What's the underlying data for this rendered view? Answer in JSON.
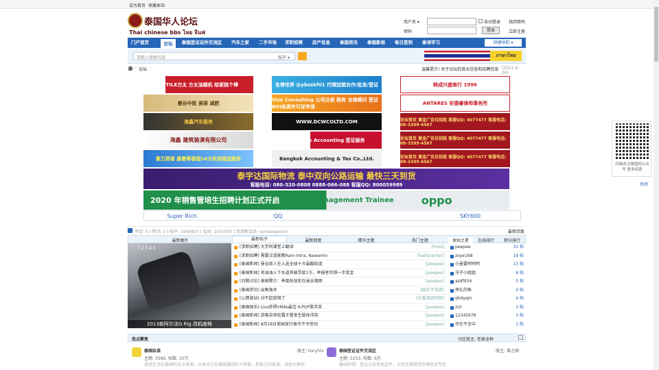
{
  "topbar": {
    "set_home": "设为首页",
    "bookmark": "收藏本站"
  },
  "logo": {
    "cn": "泰国华人论坛",
    "en": "Thai chinese bbs ไทย จีนฟอรั่ม"
  },
  "login": {
    "username_label": "用户名 ▾",
    "password_label": "密码",
    "auto_login": "自动登录",
    "forgot": "找回密码",
    "login_btn": "登录",
    "register": "立即注册"
  },
  "nav": {
    "items": [
      "门户首页",
      "论坛",
      "泰国签证证件交流区",
      "汽车之家",
      "二手市场",
      "求职招聘",
      "房产信息",
      "泰国资讯",
      "泰国影视",
      "每日签到",
      "泰语学习"
    ],
    "active_index": 1,
    "quick": "快捷导航 ▾",
    "colors": {
      "bar": "#2566b8"
    }
  },
  "search": {
    "placeholder": "请输入搜索内容",
    "type": "帖子 ▾",
    "thai_label": "ภาษาไทย"
  },
  "breadcrumb": {
    "current": "论坛",
    "notice": "温馨提示! 关于论坛的商业信息和招聘信息",
    "notice_date": "(2011-6-26)"
  },
  "ads": {
    "row1": [
      "FOTILE方太 方太油烟机 给家挑个棒",
      "名律世界 @ybzskf01 代理加盟合作/批发/签证",
      "韩成兴盛商行 1996"
    ],
    "row2": [
      "曼谷中医 美容 减肥",
      "Vize Consulting 公司注册 税务 法律顾问 签证 BOI各类许可证申请",
      "ANTARES 安德睿律师事务所"
    ],
    "row3": [
      "海鑫汽车服务",
      "WWW.DCWCOLTD.COM",
      "论坛首页 黄金广告位招租 客服QQ: 4077477 客服电话: 08-3399-4567"
    ],
    "row4": [
      "海鑫 建筑装潢有限公司",
      "Bangkok Accounting 签证服务",
      "论坛首页 黄金广告位招租 客服QQ: 4077477 客服电话: 08-3399-4567"
    ],
    "row5": [
      "素万那普 廊曼等泰国14大机场接送服务",
      "Bangkok Accounting & Tax Co.,Ltd.",
      "论坛首页 黄金广告位招租 客服QQ: 4077477 客服电话: 08-3399-4567"
    ],
    "wide1": "泰宇达国际物流  泰中双向公路运输  最快三天到货",
    "wide1_sub": "客服电话: 080-520-0808   0888-066-088   客服QQ: 800059989",
    "wide2": "2020 年销售管培生招聘计划正式开启",
    "wide2_en": "Sale Management Trainee",
    "wide2_brand": "oppo"
  },
  "links": [
    "Super Rich",
    "QQ",
    "SKY600"
  ],
  "stats": {
    "text": "今日: 0 | 昨日: 2 | 帖子: 1660837 | 会员: 1601005 | 欢迎新会员: ezirokxapovix",
    "right": "最新回复"
  },
  "tabs": [
    "最新图片",
    "最新帖子",
    "最新回复",
    "精华主题",
    "热门主题",
    "发贴之星",
    "在线排行",
    "积分排行"
  ],
  "photo": {
    "caption": "2013款阿尔法G Rig 改机座椅",
    "pager": "1  2  3  4  5"
  },
  "threads": [
    {
      "title": "[求职招聘] 大学同课堂上翻译",
      "author": "[miss]"
    },
    {
      "title": "[求职招聘] 需要汉语家教Ram-Intra, Nawamin",
      "author": "[haifucenter]"
    },
    {
      "title": "[泰国新闻] 曼谷商人在入选全球十大最酷街道",
      "author": "[peepee]"
    },
    {
      "title": "[泰国新闻] 将油油入下水道将被罚款1万，举报者可得一半奖金",
      "author": "[peepee]"
    },
    {
      "title": "[问题讨论] 泰国警方：季度抢劫犯在曼谷落网",
      "author": "[peepee]"
    },
    {
      "title": "[泰国资讯] 出售独木",
      "author": "[四在不流浪]"
    },
    {
      "title": "[心情驿站] 对不起我错了",
      "author": "[分爱我卯时刻]"
    },
    {
      "title": "[泰国娱乐] Lisa获得VMAs最佳 K-POP歌手奖",
      "author": "[peepee]"
    },
    {
      "title": "[泰国新闻] 游客自驾吃霸王餐发生肢体冲突",
      "author": "[peepee]"
    },
    {
      "title": "[泰国新闻] 8月28日美国发行泰币不予受动",
      "author": "[peepee]"
    }
  ],
  "ranks": [
    {
      "name": "peepee",
      "val": "31 帖"
    },
    {
      "name": "zoye168",
      "val": "18 帖"
    },
    {
      "name": "小曼要呵呵呵",
      "val": "15 帖"
    },
    {
      "name": "洋子小姐姐",
      "val": "8 帖"
    },
    {
      "name": "asdf934",
      "val": "5 帖"
    },
    {
      "name": "挣扎的鱼",
      "val": "4 帖"
    },
    {
      "name": "qhdyqm",
      "val": "4 帖"
    },
    {
      "name": "zizi",
      "val": "3 帖"
    },
    {
      "name": "12345678",
      "val": "3 帖"
    },
    {
      "name": "尽在不言中",
      "val": "3 帖"
    }
  ],
  "section": {
    "title": "热点聚焦",
    "mod": "分区版主: 老泰龙种"
  },
  "forums": [
    {
      "name": "泰国杂谈",
      "mod": "版主: tonyhtx",
      "stats": "主题: 3589, 帖数: 10万",
      "desc": "讲述生活在泰国的点点滴滴，分享自己在泰国遇到的人和事，把自己的故事，讲给大家听。"
    },
    {
      "name": "泰国签证证件交流区",
      "mod": "版主: 事之婉",
      "stats": "主题: 5253, 帖数: 6万",
      "desc": "泰国护照、签证以及其他证件，公司注册程序办理交流专区"
    }
  ],
  "qr": {
    "text": "扫描关注泰国网公众号 更多惊喜",
    "close": "关闭"
  }
}
